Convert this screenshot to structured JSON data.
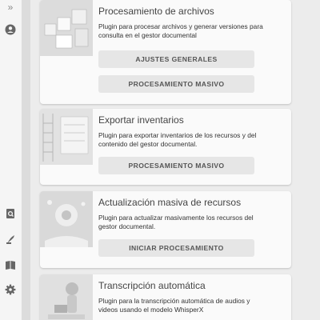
{
  "sidebar": {
    "icons": [
      {
        "name": "expand",
        "glyph": "»"
      },
      {
        "name": "account"
      },
      {
        "name": "search-document"
      },
      {
        "name": "tools"
      },
      {
        "name": "book"
      },
      {
        "name": "settings"
      }
    ]
  },
  "cards": [
    {
      "title": "Procesamiento de archivos",
      "description": "Plugin para procesar archivos y generar versiones para consulta en el gestor documental",
      "buttons": [
        "AJUSTES GENERALES",
        "PROCESAMIENTO MASIVO"
      ]
    },
    {
      "title": "Exportar inventarios",
      "description": "Plugin para exportar inventarios de los recursos y del contenido del gestor documental.",
      "buttons": [
        "PROCESAMIENTO MASIVO"
      ]
    },
    {
      "title": "Actualización masiva de recursos",
      "description": "Plugin para actualizar masivamente los recursos del gestor documental.",
      "buttons": [
        "INICIAR PROCESAMIENTO"
      ]
    },
    {
      "title": "Transcripción automática",
      "description": "Plugin para la transcripción automática de audios y videos usando el modelo WhisperX",
      "buttons": []
    }
  ]
}
